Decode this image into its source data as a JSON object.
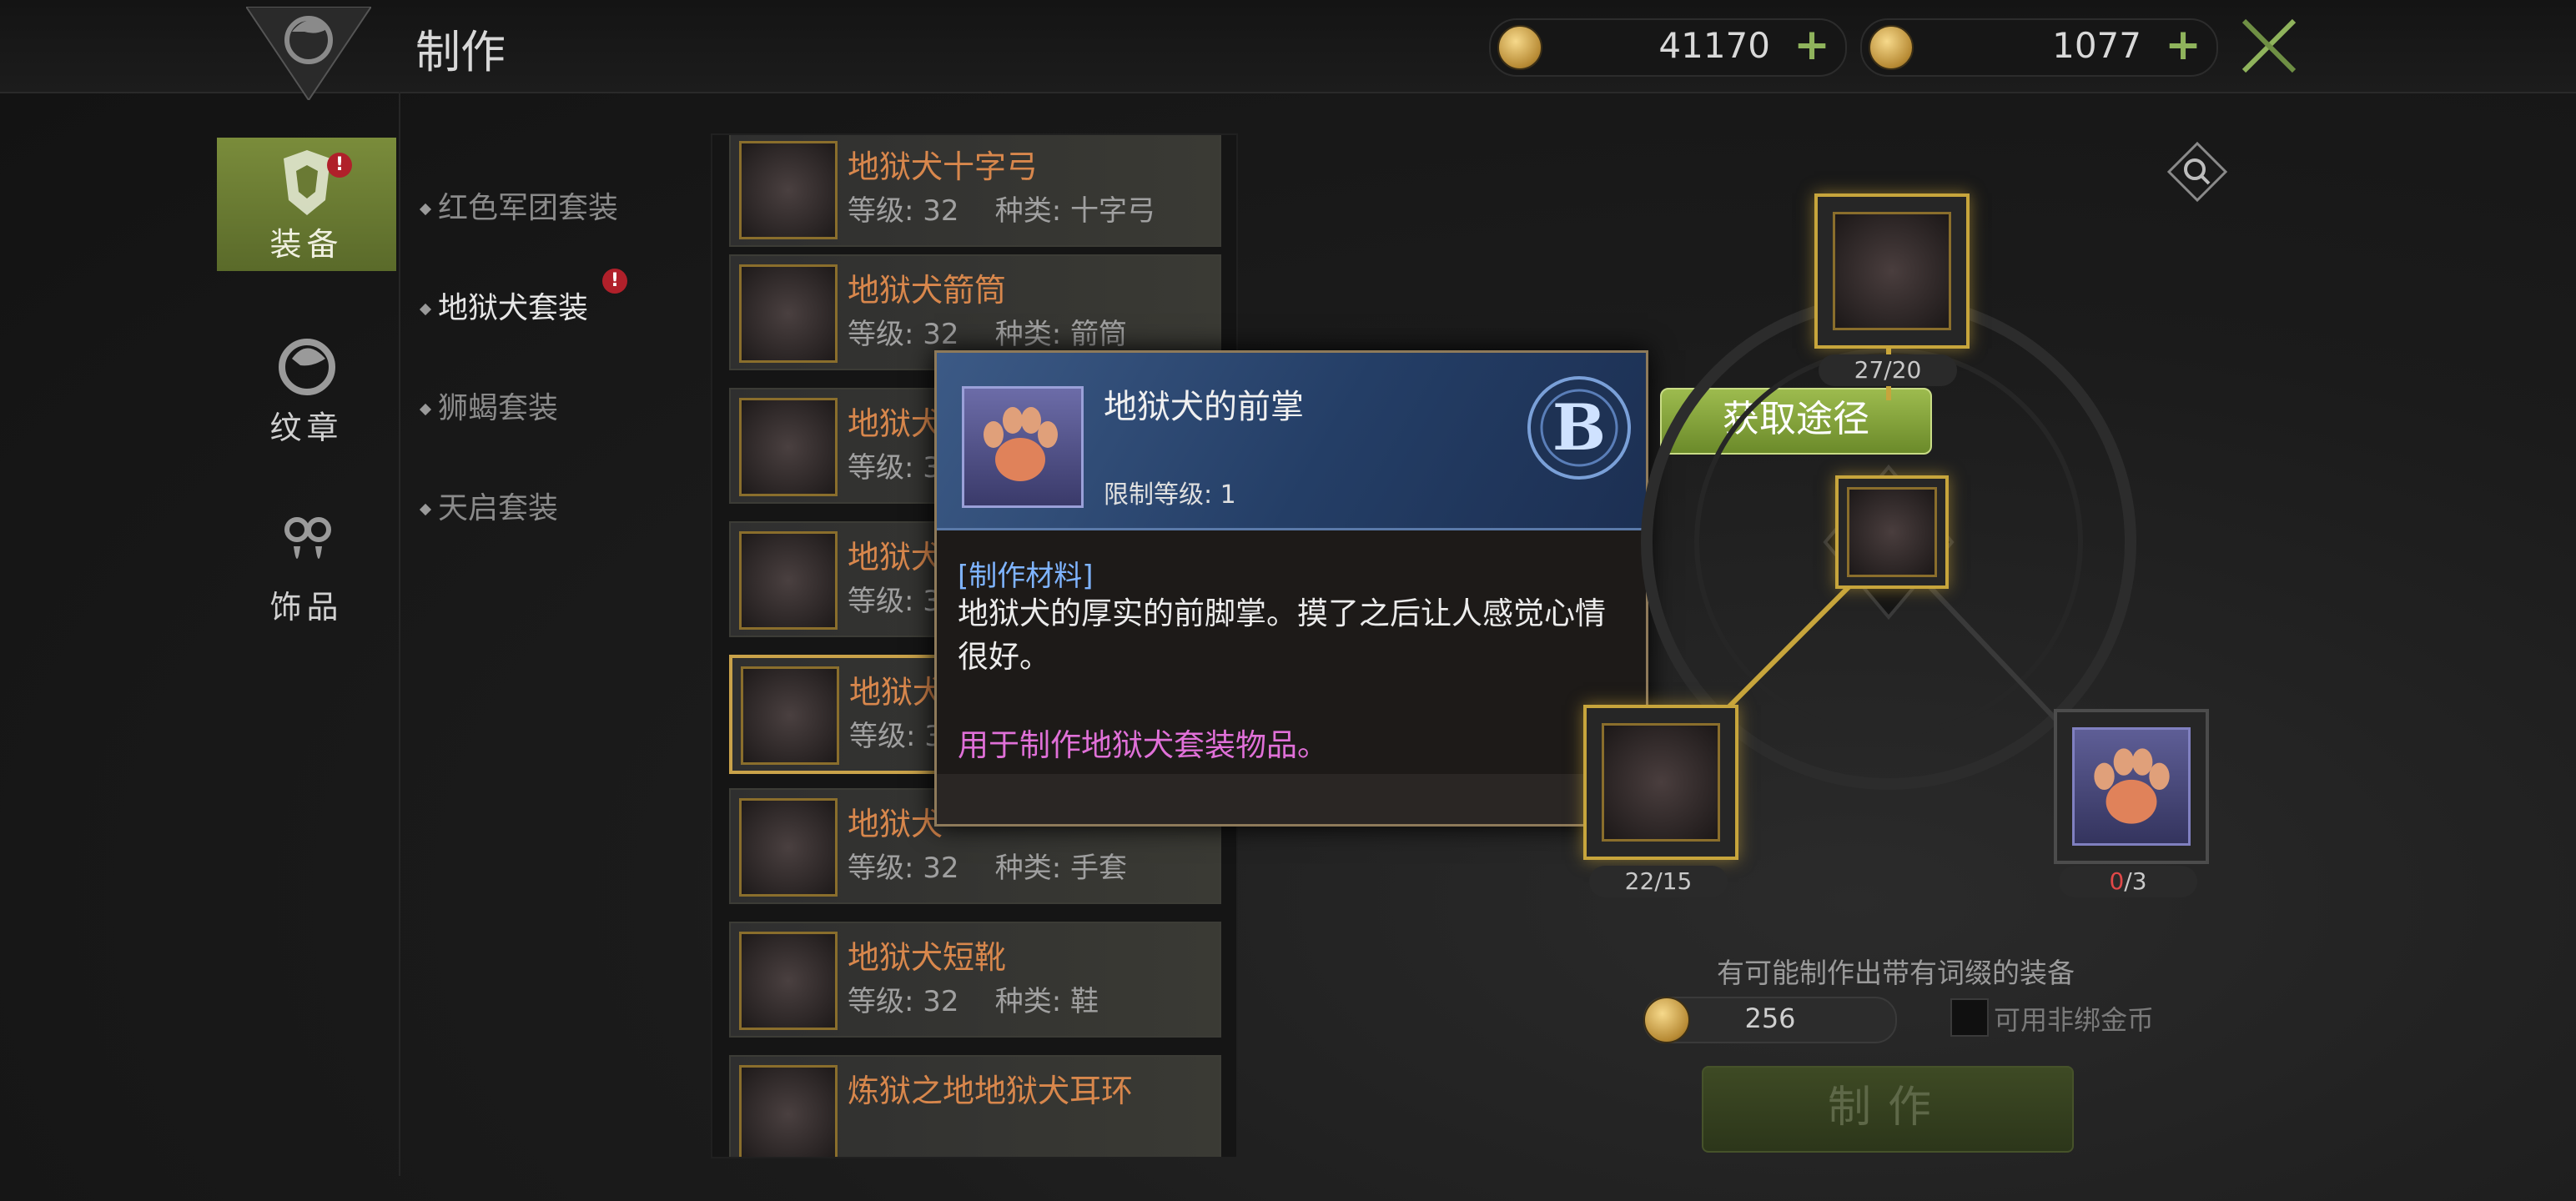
{
  "header": {
    "title": "制作"
  },
  "currencies": [
    {
      "name": "bound-gold",
      "value": "41170"
    },
    {
      "name": "gold",
      "value": "1077"
    }
  ],
  "nav": [
    {
      "label": "装备",
      "badge": "!"
    },
    {
      "label": "纹章"
    },
    {
      "label": "饰品"
    }
  ],
  "subnav": [
    {
      "label": "红色军团套装"
    },
    {
      "label": "地狱犬套装",
      "badge": "!"
    },
    {
      "label": "狮蝎套装"
    },
    {
      "label": "天启套装"
    }
  ],
  "items": [
    {
      "name": "地狱犬十字弓",
      "level": "等级: 32",
      "kind": "种类: 十字弓"
    },
    {
      "name": "地狱犬箭筒",
      "level": "等级: 32",
      "kind": "种类: 箭筒"
    },
    {
      "name": "地狱犬",
      "level": "等级: 3"
    },
    {
      "name": "地狱犬",
      "level": "等级: 3"
    },
    {
      "name": "地狱犬",
      "level": "等级: 3"
    },
    {
      "name": "地狱犬",
      "level": "等级: 32",
      "kind": "种类: 手套"
    },
    {
      "name": "地狱犬短靴",
      "level": "等级: 32",
      "kind": "种类: 鞋"
    },
    {
      "name": "炼狱之地地狱犬耳环"
    }
  ],
  "tooltip": {
    "name": "地狱犬的前掌",
    "level": "限制等级: 1",
    "grade": "B",
    "type": "[制作材料]",
    "desc": "地狱犬的厚实的前脚掌。摸了之后让人感觉心情很好。",
    "usage": "用于制作地狱犬套装物品。"
  },
  "source_button": "获取途径",
  "materials": [
    {
      "count_a": "27",
      "count_b": "/20"
    },
    {
      "count_a": "22",
      "count_b": "/15"
    },
    {
      "count_a": "0",
      "count_b": "/3"
    }
  ],
  "hint": "有可能制作出带有词缀的装备",
  "gold_cost": "256",
  "unbound_label": "可用非绑金币",
  "craft_button": "制作",
  "colors": {
    "accent": "#8fb35c",
    "item_name": "#d8874c",
    "usage": "#e070d8",
    "material_type": "#7fb4ff"
  }
}
